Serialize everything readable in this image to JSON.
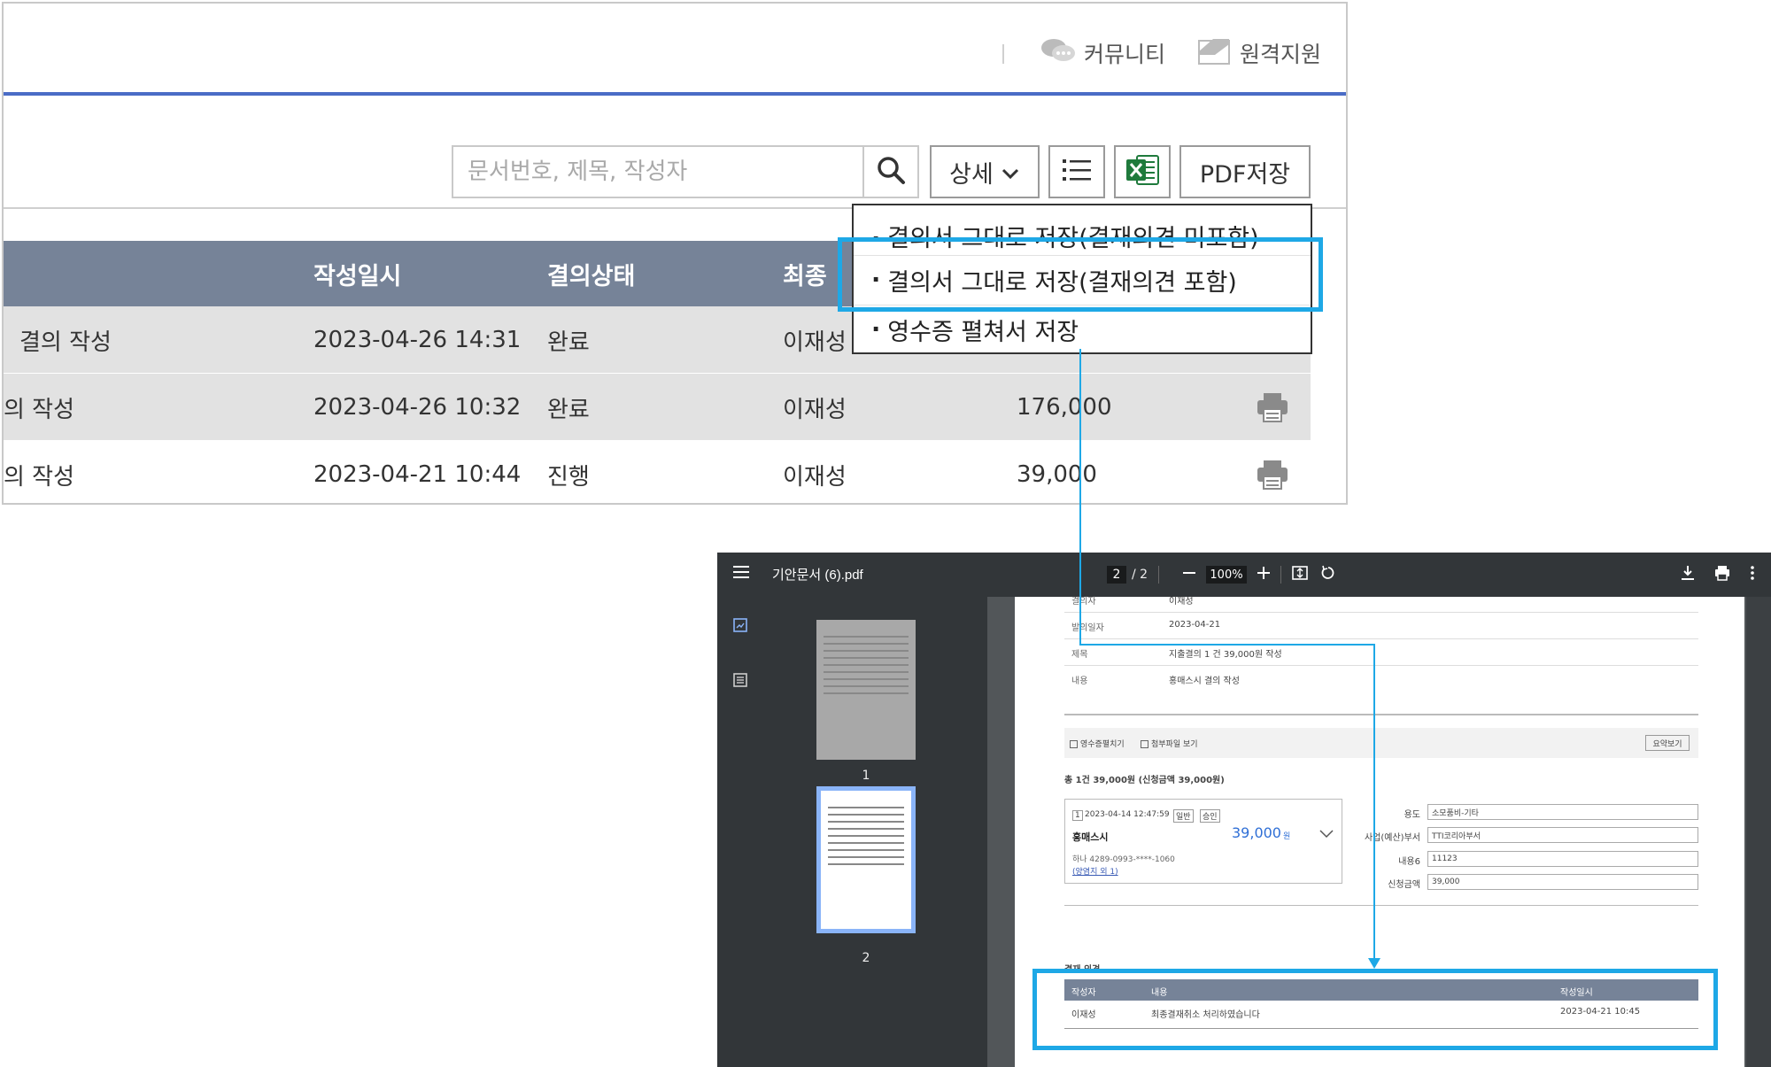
{
  "header": {
    "community_label": "커뮤니티",
    "remote_label": "원격지원"
  },
  "toolbar": {
    "search_placeholder": "문서번호, 제목, 작성자",
    "detail_label": "상세",
    "pdf_label": "PDF저장"
  },
  "dropdown": {
    "items": [
      "결의서 그대로 저장(결재의견 미포함)",
      "결의서 그대로 저장(결재의견 포함)",
      "영수증 펼쳐서 저장"
    ]
  },
  "table": {
    "headers": {
      "date": "작성일시",
      "status": "결의상태",
      "last": "최종"
    },
    "rows": [
      {
        "title": "결의 작성",
        "date": "2023-04-26 14:31",
        "status": "완료",
        "user": "이재성",
        "amount": ""
      },
      {
        "title": "의 작성",
        "date": "2023-04-26 10:32",
        "status": "완료",
        "user": "이재성",
        "amount": "176,000"
      },
      {
        "title": "의 작성",
        "date": "2023-04-21 10:44",
        "status": "진행",
        "user": "이재성",
        "amount": "39,000"
      }
    ]
  },
  "pdf_viewer": {
    "file_name": "기안문서 (6).pdf",
    "page_current": "2",
    "page_total": "/ 2",
    "zoom": "100%",
    "thumb1_label": "1",
    "thumb2_label": "2"
  },
  "pdf_doc": {
    "top_partial_label": "결의자",
    "top_partial_value": "이재성",
    "rows": [
      {
        "label": "발의일자",
        "value": "2023-04-21"
      },
      {
        "label": "제목",
        "value": "지출결의 1 건 39,000원 작성"
      },
      {
        "label": "내용",
        "value": "홍매스시 결의 작성"
      }
    ],
    "checkbox_receipt": "영수증펼치기",
    "checkbox_attach": "첨부파일 보기",
    "summary_btn": "요약보기",
    "total_line": "총 1건 39,000원 (신청금액 39,000원)",
    "card": {
      "index": "1",
      "datetime": "2023-04-14 12:47:59",
      "tag_general": "일반",
      "tag_approved": "승인",
      "merchant": "홍매스시",
      "amount": "39,000",
      "amount_unit": "원",
      "card_info": "하나 4289-0993-****-1060",
      "card_link": "(양염지 외 1)"
    },
    "fields": [
      {
        "label": "용도",
        "value": "소모품비-기타"
      },
      {
        "label": "사업(예산)부서",
        "value": "TTI코리아부서"
      },
      {
        "label": "내용6",
        "value": "11123"
      },
      {
        "label": "신청금액",
        "value": "39,000"
      }
    ],
    "opinion_title": "결재 의견",
    "opinion_headers": {
      "writer": "작성자",
      "content": "내용",
      "date": "작성일시"
    },
    "opinion_row": {
      "writer": "이재성",
      "content": "최종결재취소 처리하였습니다",
      "date": "2023-04-21 10:45"
    }
  },
  "colors": {
    "accent_blue": "#4a6cc6",
    "table_header": "#768398",
    "highlight": "#1ea8e6",
    "excel_green": "#1f7a3c"
  }
}
